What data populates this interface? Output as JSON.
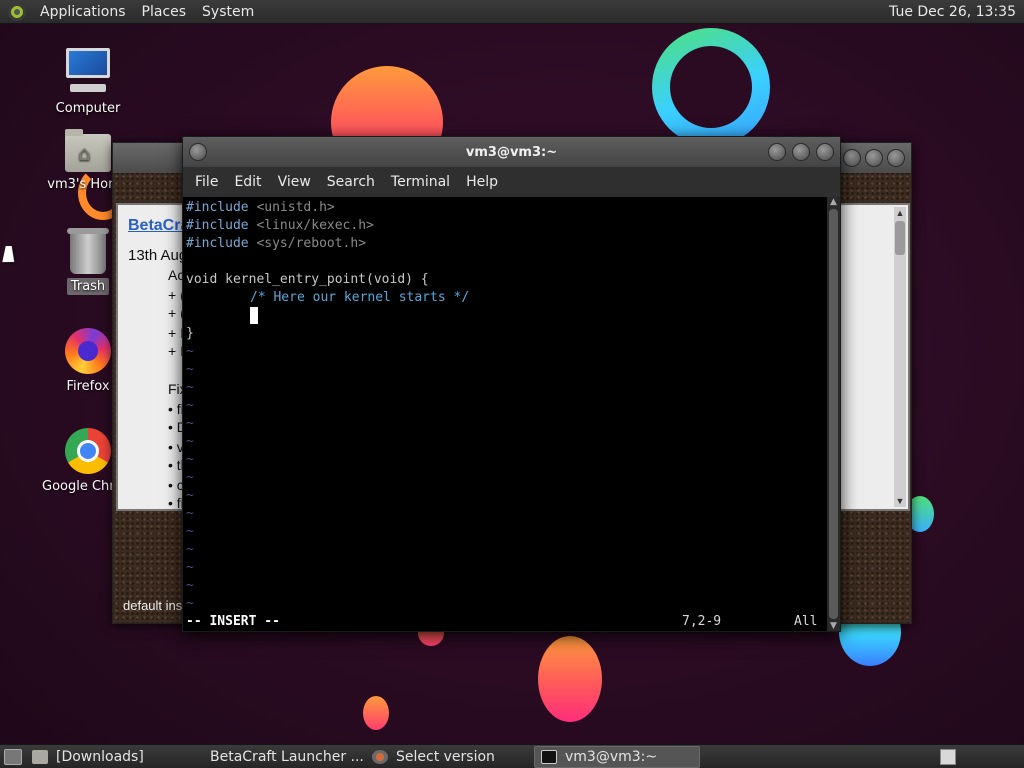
{
  "top_panel": {
    "menus": [
      "Applications",
      "Places",
      "System"
    ],
    "clock": "Tue Dec 26, 13:35"
  },
  "desktop_icons": [
    {
      "label": "Computer",
      "icon": "computer-icon"
    },
    {
      "label": "vm3's Home",
      "icon": "home-folder-icon"
    },
    {
      "label": "Trash",
      "icon": "trash-icon"
    },
    {
      "label": "Firefox",
      "icon": "firefox-icon"
    },
    {
      "label": "Google Chrome",
      "icon": "chrome-icon"
    }
  ],
  "background_window": {
    "news_title": "BetaCraft",
    "news_date": "13th Aug",
    "lines": [
      "Ac",
      "+ (",
      "+ (",
      "+ I",
      "+ I",
      "Fix",
      "• fi",
      "• D",
      "• v",
      "• th",
      "• c",
      "• fi"
    ],
    "footer": "default ins"
  },
  "terminal": {
    "title": "vm3@vm3:~",
    "menu": [
      "File",
      "Edit",
      "View",
      "Search",
      "Terminal",
      "Help"
    ],
    "code": {
      "line1_directive": "#include",
      "line1_header": "<unistd.h>",
      "line2_directive": "#include",
      "line2_header": "<linux/kexec.h>",
      "line3_directive": "#include",
      "line3_header": "<sys/reboot.h>",
      "line5": "void kernel_entry_point(void) {",
      "line6": "/* Here our kernel starts */",
      "line8": "}"
    },
    "tilde": "~",
    "status_mode": "-- INSERT --",
    "status_position": "7,2-9",
    "status_scroll": "All"
  },
  "taskbar": {
    "tasks": [
      {
        "label": "[Downloads]",
        "icon": "folder-icon"
      },
      {
        "label": "BetaCraft Launcher ...",
        "icon": "java-icon"
      },
      {
        "label": "Select version",
        "icon": "java-icon"
      },
      {
        "label": "vm3@vm3:~",
        "icon": "terminal-icon"
      }
    ]
  }
}
